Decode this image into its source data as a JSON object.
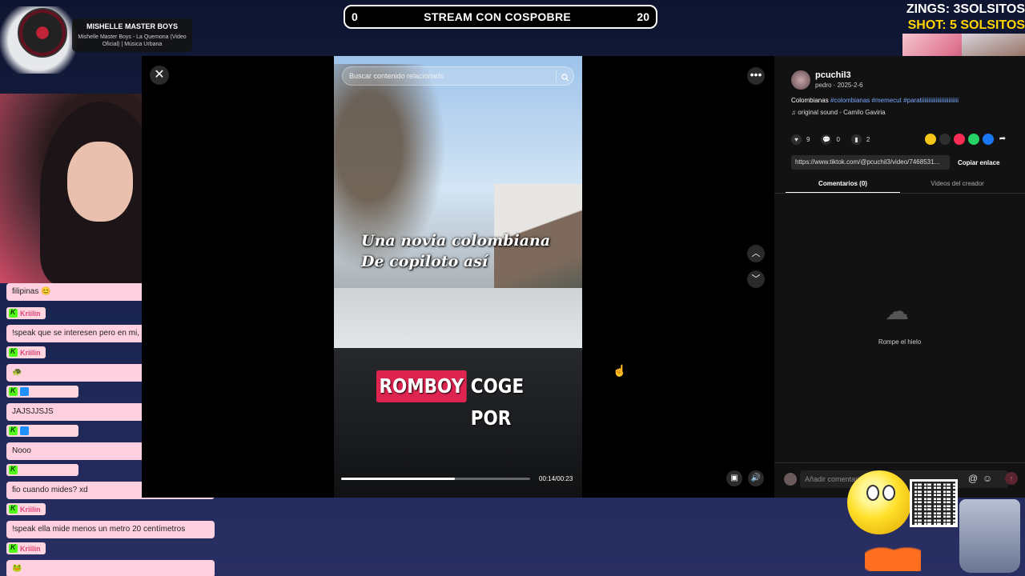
{
  "overlay": {
    "now_playing_title": "MISHELLE MASTER BOYS",
    "now_playing_song": "Mishelle Master Boys - La Quemona (Video Oficial) | Música Urbana",
    "score_left": "0",
    "score_title": "STREAM CON COSPOBRE",
    "score_right": "20",
    "zings": "ZINGS: 3SOLSITOS",
    "shot": "SHOT: 5 SOLSITOS"
  },
  "chat": {
    "messages": [
      {
        "user": "",
        "text": "filipinas 😊"
      },
      {
        "user": "Kriilin",
        "text": "!speak que se interesen pero en mi, porfa"
      },
      {
        "user": "Kriilin",
        "text": "🐢"
      },
      {
        "user": "",
        "text": "JAJSJJSJS"
      },
      {
        "user": "",
        "text": "Nooo"
      },
      {
        "user": "",
        "text": "fio cuando mides? xd"
      },
      {
        "user": "Kriilin",
        "text": "!speak ella mide menos un metro 20 centímetros"
      },
      {
        "user": "Kriilin",
        "text": "🐸"
      }
    ]
  },
  "viewer": {
    "search_placeholder": "Buscar contenido relacionado",
    "caption_top_line1": "Una novia colombiana",
    "caption_top_line2": "De copiloto así",
    "caption_bottom_highlight": "ROMBOY",
    "caption_bottom_rest": "COGE POR",
    "time_readout": "00:14/00:23",
    "progress": 0.6
  },
  "panel": {
    "username": "pcuchil3",
    "user_meta": "pedro · 2025-2-6",
    "desc_text": "Colombianas ",
    "desc_tags": "#colombianas #memecut #paratiiiiiiiiiiiiiiiiiiiiiiiiii",
    "sound": "original sound - Camilo Gaviria",
    "likes": "9",
    "comments": "0",
    "saves": "2",
    "link": "https://www.tiktok.com/@pcuchil3/video/7468531...",
    "copy_label": "Copiar enlace",
    "tab_comments": "Comentarios (0)",
    "tab_creator": "Videos del creador",
    "empty_text": "Rompe el hielo",
    "comment_placeholder": "Añadir comentario..."
  },
  "colors": {
    "accent_pink": "#e02450",
    "chat_bubble": "#ffd1e0",
    "kick_green": "#53fc18",
    "shot_yellow": "#ffd400"
  }
}
